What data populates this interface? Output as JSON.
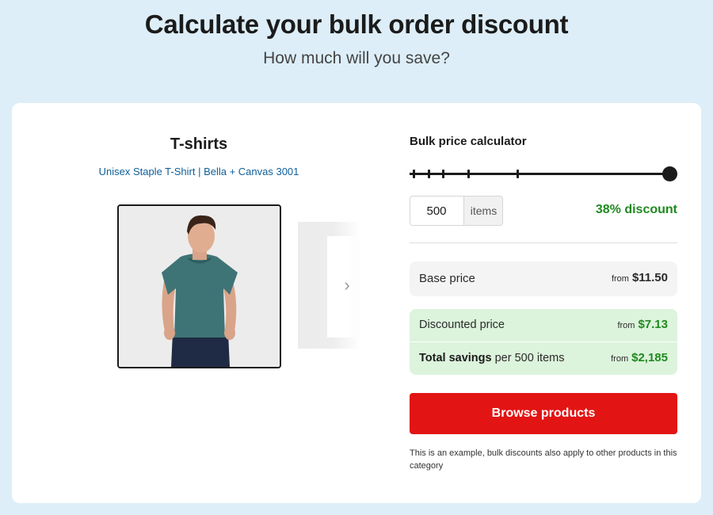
{
  "header": {
    "title": "Calculate your bulk order discount",
    "subtitle": "How much will you save?"
  },
  "product": {
    "title": "T-shirts",
    "subtitle": "Unisex Staple T-Shirt | Bella + Canvas 3001",
    "image_icon": "person-in-teal-tshirt",
    "next_icon": "chevron-right-icon",
    "next_glyph": "›"
  },
  "calculator": {
    "title": "Bulk price calculator",
    "slider_level": 1.0,
    "quantity": "500",
    "quantity_unit": "items",
    "discount": "38% discount",
    "base_price": {
      "label": "Base price",
      "from": "from",
      "amount": "$11.50"
    },
    "discounted_price": {
      "label": "Discounted price",
      "from": "from",
      "amount": "$7.13"
    },
    "total_savings": {
      "label_bold": "Total savings",
      "label_rest": " per 500 items",
      "from": "from",
      "amount": "$2,185"
    },
    "button_label": "Browse products",
    "footnote": "This is an example, bulk discounts also apply to other products in this category"
  },
  "colors": {
    "background": "#ddeef8",
    "accent_red": "#e31414",
    "discount_green": "#1f8a1f",
    "savings_panel": "#dcf3dc",
    "link_blue": "#0e5f99"
  }
}
